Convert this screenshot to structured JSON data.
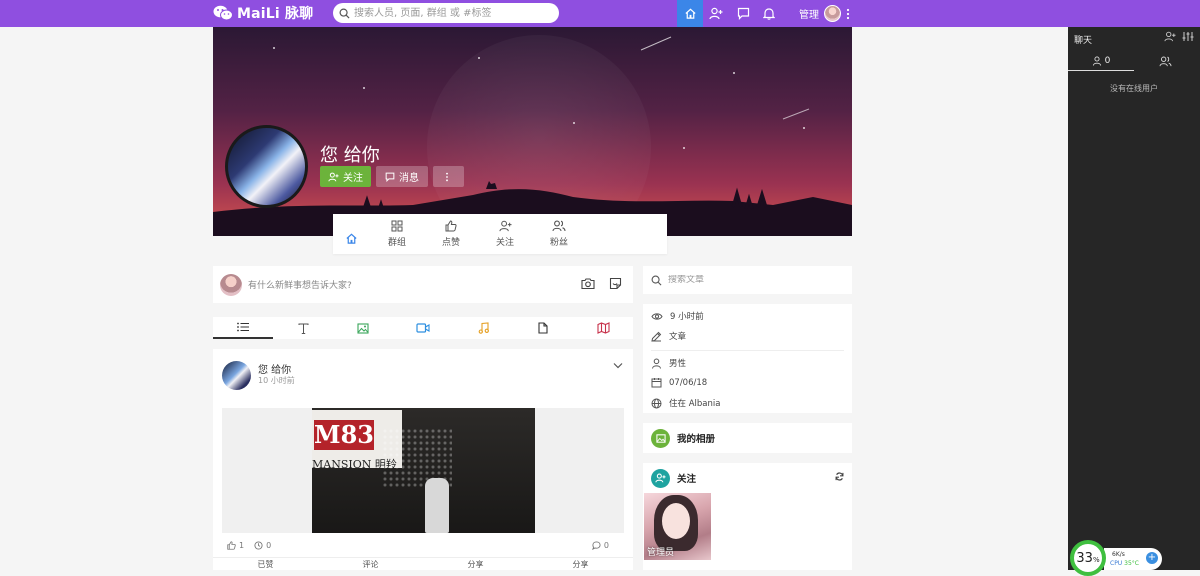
{
  "topbar": {
    "logo_text": "MaiLi 脉聊",
    "search_placeholder": "搜索人员, 页面, 群组 或 #标签",
    "admin_label": "管理",
    "accent": "#8f4fe0"
  },
  "profile": {
    "name": "您 给你",
    "follow_label": "关注",
    "message_label": "消息"
  },
  "tabs": [
    {
      "label": ""
    },
    {
      "label": "群组"
    },
    {
      "label": "点赞"
    },
    {
      "label": "关注"
    },
    {
      "label": "粉丝"
    }
  ],
  "composer": {
    "placeholder": "有什么新鲜事想告诉大家?"
  },
  "post": {
    "author": "您 给你",
    "time": "10 小时前",
    "likes": "1",
    "views": "0",
    "comments": "0",
    "photo_sign_top": "M83",
    "photo_sign_bottom": "MANSION 明羚",
    "actions": [
      "已赞",
      "评论",
      "分享",
      "分享"
    ]
  },
  "sidebar": {
    "search_placeholder": "搜索文章",
    "info": {
      "last_seen": "9 小时前",
      "posts": "文章",
      "gender": "男性",
      "birthday": "07/06/18",
      "location": "住在 Albania"
    },
    "album_title": "我的相册",
    "following_title": "关注",
    "following_user": "管理员"
  },
  "chat": {
    "title": "聊天",
    "online_count": "0",
    "empty": "没有在线用户"
  },
  "widget": {
    "percent": "33",
    "speed": "6K/s",
    "cpu": "CPU",
    "temp": "35°C"
  }
}
